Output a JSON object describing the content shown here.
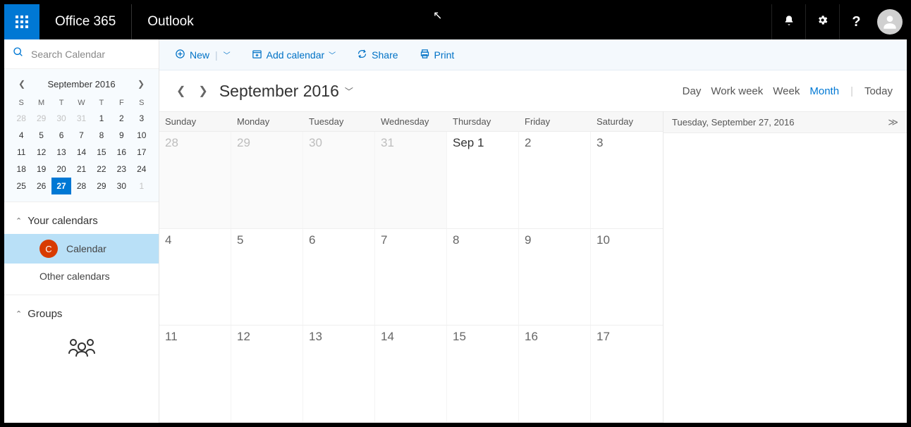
{
  "header": {
    "brand": "Office 365",
    "app": "Outlook"
  },
  "search": {
    "placeholder": "Search Calendar"
  },
  "miniCal": {
    "title": "September 2016",
    "dow": [
      "S",
      "M",
      "T",
      "W",
      "T",
      "F",
      "S"
    ],
    "days": [
      {
        "n": "28",
        "m": true
      },
      {
        "n": "29",
        "m": true
      },
      {
        "n": "30",
        "m": true
      },
      {
        "n": "31",
        "m": true
      },
      {
        "n": "1"
      },
      {
        "n": "2"
      },
      {
        "n": "3"
      },
      {
        "n": "4"
      },
      {
        "n": "5"
      },
      {
        "n": "6"
      },
      {
        "n": "7"
      },
      {
        "n": "8"
      },
      {
        "n": "9"
      },
      {
        "n": "10"
      },
      {
        "n": "11"
      },
      {
        "n": "12"
      },
      {
        "n": "13"
      },
      {
        "n": "14"
      },
      {
        "n": "15"
      },
      {
        "n": "16"
      },
      {
        "n": "17"
      },
      {
        "n": "18"
      },
      {
        "n": "19"
      },
      {
        "n": "20"
      },
      {
        "n": "21"
      },
      {
        "n": "22"
      },
      {
        "n": "23"
      },
      {
        "n": "24"
      },
      {
        "n": "25"
      },
      {
        "n": "26"
      },
      {
        "n": "27",
        "sel": true
      },
      {
        "n": "28"
      },
      {
        "n": "29"
      },
      {
        "n": "30"
      },
      {
        "n": "1",
        "m": true
      }
    ]
  },
  "sections": {
    "yourCalendars": "Your calendars",
    "calendarItem": {
      "initial": "C",
      "label": "Calendar",
      "color": "#d83b01"
    },
    "otherCalendars": "Other calendars",
    "groups": "Groups"
  },
  "cmd": {
    "new": "New",
    "addCal": "Add calendar",
    "share": "Share",
    "print": "Print"
  },
  "monthTitle": "September 2016",
  "views": {
    "day": "Day",
    "workweek": "Work week",
    "week": "Week",
    "month": "Month",
    "today": "Today",
    "active": "month"
  },
  "dowFull": [
    "Sunday",
    "Monday",
    "Tuesday",
    "Wednesday",
    "Thursday",
    "Friday",
    "Saturday"
  ],
  "weeks": [
    [
      {
        "n": "28",
        "out": true
      },
      {
        "n": "29",
        "out": true
      },
      {
        "n": "30",
        "out": true
      },
      {
        "n": "31",
        "out": true
      },
      {
        "n": "Sep 1",
        "first": true
      },
      {
        "n": "2"
      },
      {
        "n": "3"
      }
    ],
    [
      {
        "n": "4"
      },
      {
        "n": "5"
      },
      {
        "n": "6"
      },
      {
        "n": "7"
      },
      {
        "n": "8"
      },
      {
        "n": "9"
      },
      {
        "n": "10"
      }
    ],
    [
      {
        "n": "11"
      },
      {
        "n": "12"
      },
      {
        "n": "13"
      },
      {
        "n": "14"
      },
      {
        "n": "15"
      },
      {
        "n": "16"
      },
      {
        "n": "17"
      }
    ]
  ],
  "agenda": {
    "dateLabel": "Tuesday, September 27, 2016"
  }
}
